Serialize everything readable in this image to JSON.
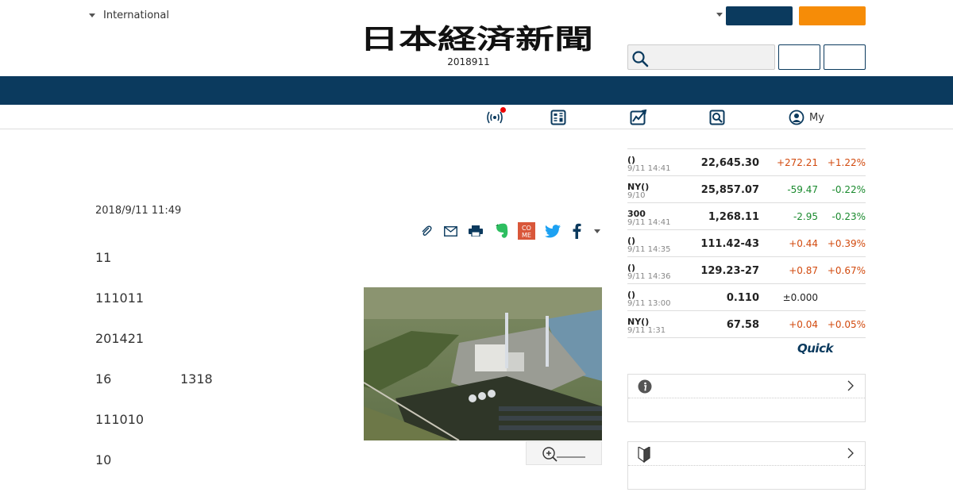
{
  "header": {
    "region_label": "International",
    "logo_text": "日本経済新聞",
    "logo_date": "2018911"
  },
  "subnav": {
    "my_label": "My"
  },
  "article": {
    "date": "2018/9/11 11:49",
    "paragraphs": [
      "11",
      "111011",
      "201421",
      "16",
      "1318",
      "111010",
      "10"
    ]
  },
  "market": {
    "rows": [
      {
        "name": "()",
        "time": "9/11 14:41",
        "value": "22,645.30",
        "change": "+272.21",
        "pct": "+1.22%",
        "dir": "up"
      },
      {
        "name": "NY()",
        "time": "9/10",
        "value": "25,857.07",
        "change": "-59.47",
        "pct": "-0.22%",
        "dir": "down"
      },
      {
        "name": "300",
        "time": "9/11 14:41",
        "value": "1,268.11",
        "change": "-2.95",
        "pct": "-0.23%",
        "dir": "down"
      },
      {
        "name": "()",
        "time": "9/11 14:35",
        "value": "111.42-43",
        "change": "+0.44",
        "pct": "+0.39%",
        "dir": "up"
      },
      {
        "name": "()",
        "time": "9/11 14:36",
        "value": "129.23-27",
        "change": "+0.87",
        "pct": "+0.67%",
        "dir": "up"
      },
      {
        "name": "()",
        "time": "9/11 13:00",
        "value": "0.110",
        "change": "±0.000",
        "pct": "",
        "dir": "flat"
      },
      {
        "name": "NY()",
        "time": "9/11 1:31",
        "value": "67.58",
        "change": "+0.04",
        "pct": "+0.05%",
        "dir": "up"
      }
    ],
    "quick_label": "Quick"
  },
  "colors": {
    "navy": "#0b3a5e",
    "orange": "#f68c07",
    "up": "#d24a0e",
    "down": "#1a8a2e"
  },
  "icons": [
    "caret-down-icon",
    "search-icon",
    "broadcast-icon",
    "paper-icon",
    "chart-icon",
    "magnify-icon",
    "user-icon",
    "clip-icon",
    "mail-icon",
    "print-icon",
    "evernote-icon",
    "come-icon",
    "twitter-icon",
    "facebook-icon",
    "info-icon",
    "beginner-icon",
    "chevron-right-icon",
    "zoom-in-icon"
  ]
}
